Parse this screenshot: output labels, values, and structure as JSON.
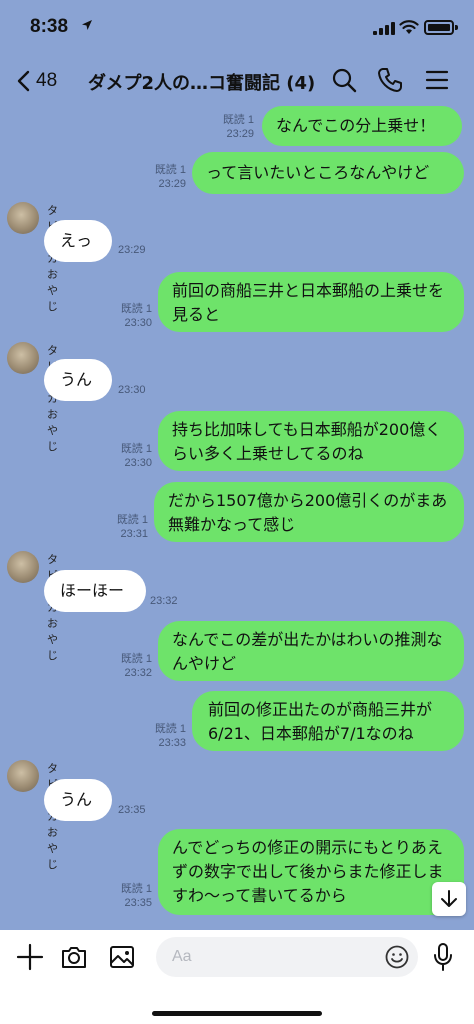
{
  "status": {
    "time": "8:38"
  },
  "header": {
    "back_count": "48",
    "title": "ダメプ2人の…コ奮闘記 (4)"
  },
  "messages": [
    {
      "text": "なんでこの分上乗せ！",
      "read": "既読 1",
      "time": "23:29"
    },
    {
      "text": "って言いたいところなんやけど",
      "read": "既読 1",
      "time": "23:29"
    },
    {
      "sender": "タピオカおやじ",
      "text": "えっ",
      "time": "23:29"
    },
    {
      "text": "前回の商船三井と日本郵船の上乗せを見ると",
      "read": "既読 1",
      "time": "23:30"
    },
    {
      "sender": "タピオカおやじ",
      "text": "うん",
      "time": "23:30"
    },
    {
      "text": "持ち比加味しても日本郵船が200億くらい多く上乗せしてるのね",
      "read": "既読 1",
      "time": "23:30"
    },
    {
      "text": "だから1507億から200億引くのがまあ無難かなって感じ",
      "read": "既読 1",
      "time": "23:31"
    },
    {
      "sender": "タピオカおやじ",
      "text": "ほーほー",
      "time": "23:32"
    },
    {
      "text": "なんでこの差が出たかはわいの推測なんやけど",
      "read": "既読 1",
      "time": "23:32"
    },
    {
      "text": "前回の修正出たのが商船三井が6/21、日本郵船が7/1なのね",
      "read": "既読 1",
      "time": "23:33"
    },
    {
      "sender": "タピオカおやじ",
      "text": "うん",
      "time": "23:35"
    },
    {
      "text": "んでどっちの修正の開示にもとりあえずの数字で出して後からまた修正しますわ〜って書いてるから",
      "read": "既読 1",
      "time": "23:35"
    }
  ],
  "input": {
    "placeholder": "Aa"
  },
  "colors": {
    "background": "#8aa3d3",
    "out_bubble": "#6ee36a",
    "in_bubble": "#ffffff"
  },
  "icons": [
    "location-arrow-icon",
    "cellular-signal-icon",
    "wifi-icon",
    "battery-icon",
    "back-chevron-icon",
    "search-icon",
    "phone-icon",
    "menu-icon",
    "arrow-down-icon",
    "plus-icon",
    "camera-icon",
    "image-icon",
    "emoji-icon",
    "microphone-icon"
  ]
}
